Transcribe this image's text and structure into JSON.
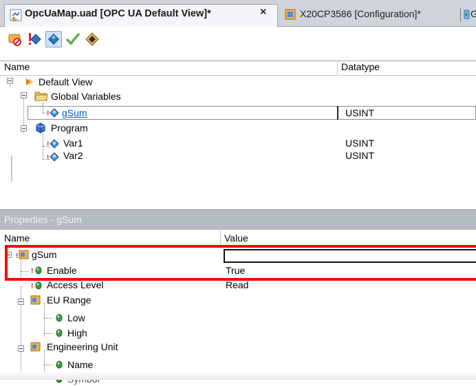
{
  "tabs": [
    {
      "label": "OpcUaMap.uad [OPC UA Default View]*",
      "active": true,
      "icon": "opc-document-icon"
    },
    {
      "label": "X20CP3586 [Configuration]*",
      "active": false,
      "icon": "configuration-icon"
    },
    {
      "label": "G",
      "active": false,
      "icon": "configuration-icon"
    }
  ],
  "tab_close_glyph": "×",
  "toolbar": {
    "buttons": [
      {
        "icon": "remove-mapping-icon"
      },
      {
        "icon": "disable-node-icon"
      },
      {
        "icon": "enable-node-icon",
        "pressed": true
      },
      {
        "icon": "checkmark-icon"
      },
      {
        "icon": "diamond-build-icon"
      }
    ]
  },
  "tree": {
    "columns": {
      "name": "Name",
      "datatype": "Datatype"
    },
    "rows": [
      {
        "label": "Default View",
        "datatype": "",
        "icon": "view-icon"
      },
      {
        "label": "Global Variables",
        "datatype": "",
        "icon": "folder-icon"
      },
      {
        "label": "gSum",
        "datatype": "USINT",
        "icon": "variable-icon",
        "selected": true
      },
      {
        "label": "Program",
        "datatype": "",
        "icon": "program-cube-icon"
      },
      {
        "label": "Var1",
        "datatype": "USINT",
        "icon": "variable-icon"
      },
      {
        "label": "Var2",
        "datatype": "USINT",
        "icon": "variable-icon"
      }
    ]
  },
  "properties": {
    "title": "Properties - gSum",
    "columns": {
      "name": "Name",
      "value": "Value"
    },
    "rows": [
      {
        "label": "gSum",
        "value": "",
        "icon": "property-group-icon"
      },
      {
        "label": "Enable",
        "value": "True",
        "icon": "property-dot-icon"
      },
      {
        "label": "Access Level",
        "value": "Read",
        "icon": "property-dot-icon"
      },
      {
        "label": "EU Range",
        "value": "",
        "icon": "property-group-icon"
      },
      {
        "label": "Low",
        "value": "",
        "icon": "property-dot-icon"
      },
      {
        "label": "High",
        "value": "",
        "icon": "property-dot-icon"
      },
      {
        "label": "Engineering Unit",
        "value": "",
        "icon": "property-group-icon"
      },
      {
        "label": "Name",
        "value": "",
        "icon": "property-dot-icon"
      },
      {
        "label": "Symbol",
        "value": "",
        "icon": "property-dot-icon"
      }
    ]
  },
  "highlight_color": "#ff0000"
}
